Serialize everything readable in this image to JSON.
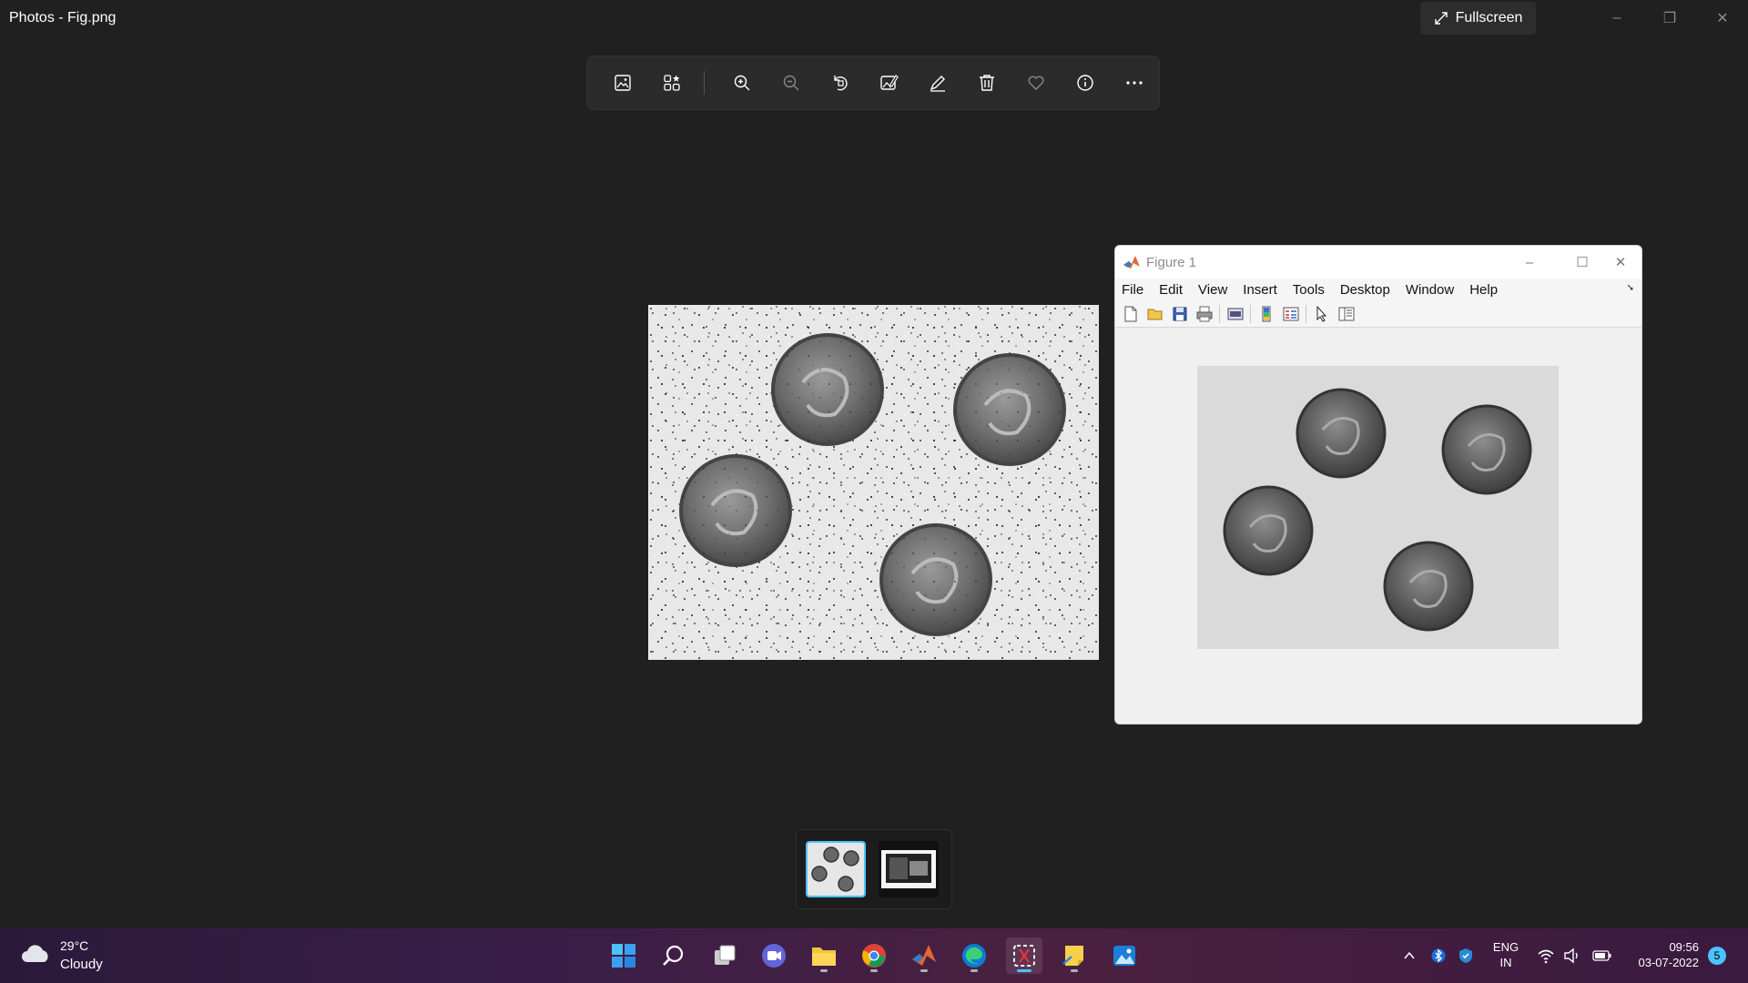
{
  "window": {
    "title": "Photos - Fig.png",
    "fullscreen_label": "Fullscreen",
    "minimize": "–",
    "restore": "❐",
    "close": "✕"
  },
  "toolbar": {
    "icons": [
      "image-icon",
      "gallery-icon",
      "zoom-in-icon",
      "zoom-out-icon",
      "rotate-icon",
      "edit-image-icon",
      "draw-icon",
      "delete-icon",
      "favorite-icon",
      "info-icon",
      "more-icon"
    ]
  },
  "figure": {
    "title": "Figure 1",
    "menu": [
      "File",
      "Edit",
      "View",
      "Insert",
      "Tools",
      "Desktop",
      "Window",
      "Help"
    ],
    "dock": "➘",
    "minimize": "–",
    "maximize": "☐",
    "close": "✕"
  },
  "filmstrip": {
    "selected_index": 0
  },
  "taskbar": {
    "weather_temp": "29°C",
    "weather_desc": "Cloudy",
    "lang_line1": "ENG",
    "lang_line2": "IN",
    "time": "09:56",
    "date": "03-07-2022",
    "notification_count": "5",
    "apps": [
      "start-icon",
      "search-icon",
      "task-view-icon",
      "teams-chat-icon",
      "file-explorer-icon",
      "chrome-icon",
      "matlab-icon",
      "edge-icon",
      "snipping-tool-icon",
      "sticky-notes-icon",
      "photos-icon"
    ]
  },
  "colors": {
    "background": "#202020",
    "accent": "#4cc2ff",
    "figure_bg": "#f0f0f0"
  }
}
